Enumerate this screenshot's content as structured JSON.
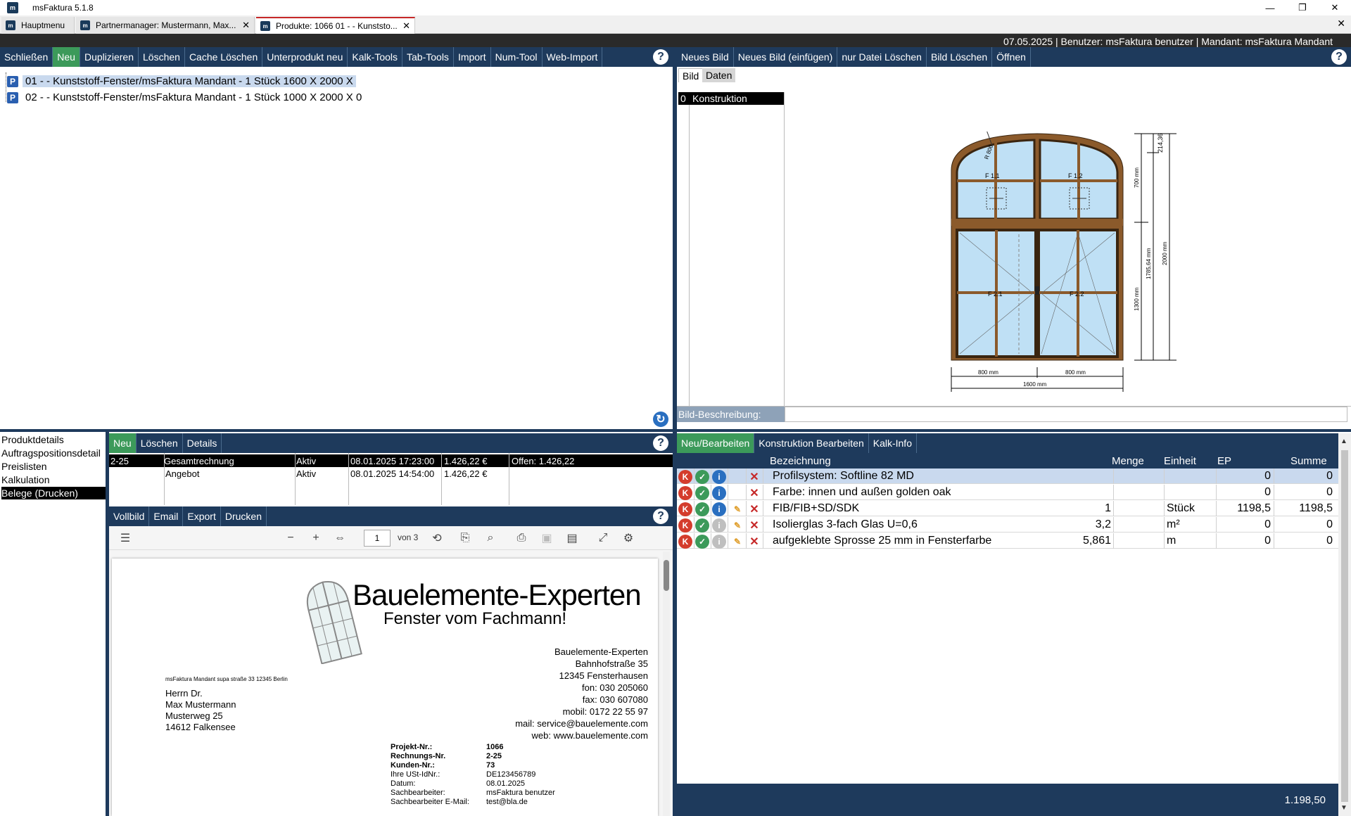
{
  "window": {
    "app_title": "msFaktura 5.1.8",
    "logo": "m"
  },
  "tabs": [
    {
      "label": "Hauptmenu"
    },
    {
      "label": "Partnermanager: Mustermann, Max..."
    },
    {
      "label": "Produkte: 1066 01 - - Kunststo..."
    }
  ],
  "status": {
    "text": "07.05.2025 | Benutzer: msFaktura benutzer | Mandant: msFaktura Mandant"
  },
  "product_toolbar": [
    "Schließen",
    "Neu",
    "Duplizieren",
    "Löschen",
    "Cache Löschen",
    "Unterprodukt neu",
    "Kalk-Tools",
    "Tab-Tools",
    "Import",
    "Num-Tool",
    "Web-Import"
  ],
  "image_toolbar": [
    "Neues Bild",
    "Neues Bild (einfügen)",
    "nur Datei Löschen",
    "Bild Löschen",
    "Öffnen"
  ],
  "tree": [
    {
      "icon": "P",
      "label": "01 - - Kunststoff-Fenster/msFaktura Mandant - 1 Stück 1600 X 2000 X"
    },
    {
      "icon": "P",
      "label": "02 -  - Kunststoff-Fenster/msFaktura Mandant - 1 Stück 1000 X 2000 X 0"
    }
  ],
  "image_tabs": [
    "Bild",
    "Daten"
  ],
  "image_list": {
    "index": "0",
    "name": "Konstruktion"
  },
  "drawing": {
    "dims": {
      "top": "214,36",
      "upper": "700 mm",
      "lower": "1300 mm",
      "side": "1785,64 mm",
      "total": "2000 mm",
      "w1": "800 mm",
      "w2": "800 mm",
      "width": "1600 mm",
      "radius": "R 800"
    },
    "labels": {
      "f11": "F 1.1",
      "f12": "F 1.2",
      "f21": "F 2.1",
      "f22": "F 2.2"
    },
    "colors": {
      "frame": "#8b5a2b",
      "glass": "#bfe0f5"
    }
  },
  "bild_beschreibung": "Bild-Beschreibung:",
  "left_nav": [
    "Produktdetails",
    "Auftragspositionsdetail",
    "Preislisten",
    "Kalkulation",
    "Belege (Drucken)"
  ],
  "beleg_toolbar": [
    "Neu",
    "Löschen",
    "Details"
  ],
  "belege": [
    {
      "nr": "2-25",
      "typ": "Gesamtrechnung",
      "status": "Aktiv",
      "datum": "08.01.2025 17:23:00",
      "betrag": "1.426,22 €",
      "offen": "Offen: 1.426,22"
    },
    {
      "nr": "",
      "typ": "Angebot",
      "status": "Aktiv",
      "datum": "08.01.2025 14:54:00",
      "betrag": "1.426,22 €",
      "offen": ""
    }
  ],
  "print_toolbar": [
    "Vollbild",
    "Email",
    "Export",
    "Drucken"
  ],
  "pdf": {
    "page": "1",
    "of": "von 3"
  },
  "doc": {
    "company": "Bauelemente-Experten",
    "slogan": "Fenster vom Fachmann!",
    "sender_line": "msFaktura Mandant supa straße 33 12345 Berlin",
    "recipient": [
      "Herrn Dr.",
      "Max Mustermann",
      "Musterweg 25",
      "14612 Falkensee"
    ],
    "address": [
      "Bauelemente-Experten",
      "Bahnhofstraße 35",
      "12345 Fensterhausen",
      "fon:  030 205060",
      "fax:  030 607080",
      "mobil: 0172 22 55 97",
      "mail: service@bauelemente.com",
      "web: www.bauelemente.com"
    ],
    "meta": [
      {
        "k": "Projekt-Nr.:",
        "v": "1066",
        "bold": true
      },
      {
        "k": "Rechnungs-Nr.",
        "v": "2-25",
        "bold": true
      },
      {
        "k": "Kunden-Nr.:",
        "v": "73",
        "bold": true
      },
      {
        "k": "Ihre USt-IdNr.:",
        "v": "DE123456789",
        "bold": false
      },
      {
        "k": "Datum:",
        "v": "08.01.2025",
        "bold": false
      },
      {
        "k": "Sachbearbeiter:",
        "v": "msFaktura benutzer",
        "bold": false
      },
      {
        "k": "Sachbearbeiter E-Mail:",
        "v": "test@bla.de",
        "bold": false
      }
    ]
  },
  "pos_toolbar": [
    "Neu/Bearbeiten",
    "Konstruktion Bearbeiten",
    "Kalk-Info"
  ],
  "pos_headers": {
    "bez": "Bezeichnung",
    "menge": "Menge",
    "einheit": "Einheit",
    "ep": "EP",
    "summe": "Summe"
  },
  "positions": [
    {
      "bez": "Profilsystem: Softline 82 MD",
      "menge": "",
      "einheit": "",
      "ep": "0",
      "summe": "0",
      "info_active": true
    },
    {
      "bez": "Farbe: innen und außen golden oak",
      "menge": "",
      "einheit": "",
      "ep": "0",
      "summe": "0",
      "info_active": true
    },
    {
      "bez": "FIB/FIB+SD/SDK",
      "menge": "1",
      "einheit": "Stück",
      "ep": "1198,5",
      "summe": "1198,5",
      "info_active": true
    },
    {
      "bez": "Isolierglas 3-fach Glas U=0,6",
      "menge": "3,2",
      "einheit": "m²",
      "ep": "0",
      "summe": "0",
      "info_active": false
    },
    {
      "bez": "aufgeklebte Sprosse 25 mm in Fensterfarbe",
      "menge": "5,861",
      "einheit": "m",
      "ep": "0",
      "summe": "0",
      "info_active": false
    }
  ],
  "icons": {
    "k": "K",
    "check": "✓",
    "info": "i",
    "edit": "✎",
    "delete": "✕",
    "help": "?",
    "refresh": "↻"
  },
  "total": "1.198,50"
}
